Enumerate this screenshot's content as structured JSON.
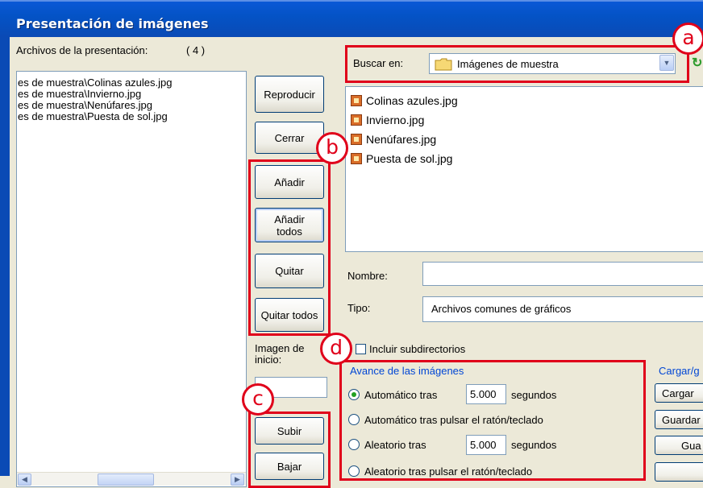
{
  "window": {
    "title": "Presentación de imágenes"
  },
  "left": {
    "files_label": "Archivos de la presentación:",
    "files_count": "( 4 )",
    "files": [
      "es de muestra\\Colinas azules.jpg",
      "es de muestra\\Invierno.jpg",
      "es de muestra\\Nenúfares.jpg",
      "es de muestra\\Puesta de sol.jpg"
    ],
    "start_image_label": "Imagen de inicio:",
    "start_image_value": ""
  },
  "buttons": {
    "play": "Reproducir",
    "close": "Cerrar",
    "add": "Añadir",
    "add_all": "Añadir todos",
    "remove": "Quitar",
    "remove_all": "Quitar todos",
    "up": "Subir",
    "down": "Bajar"
  },
  "browser": {
    "look_in_label": "Buscar en:",
    "look_in_value": "Imágenes de muestra",
    "files": [
      "Colinas azules.jpg",
      "Invierno.jpg",
      "Nenúfares.jpg",
      "Puesta de sol.jpg"
    ],
    "name_label": "Nombre:",
    "name_value": "",
    "type_label": "Tipo:",
    "type_value": "Archivos comunes de gráficos",
    "include_subdirs": "Incluir subdirectorios"
  },
  "advance": {
    "group_label": "Avance de las imágenes",
    "opt1": "Automático tras",
    "opt1_value": "5.000",
    "opt1_unit": "segundos",
    "opt2": "Automático tras pulsar el ratón/teclado",
    "opt3": "Aleatorio tras",
    "opt3_value": "5.000",
    "opt3_unit": "segundos",
    "opt4": "Aleatorio tras pulsar el ratón/teclado"
  },
  "loadsave": {
    "group_label": "Cargar/g",
    "load": "Cargar",
    "save": "Guardar",
    "save2": "Gua"
  },
  "annotations": {
    "a": "a",
    "b": "b",
    "c": "c",
    "d": "d"
  },
  "colors": {
    "highlight": "#e0001a",
    "title_bar": "#0a58d6",
    "group_label": "#0046d5"
  }
}
